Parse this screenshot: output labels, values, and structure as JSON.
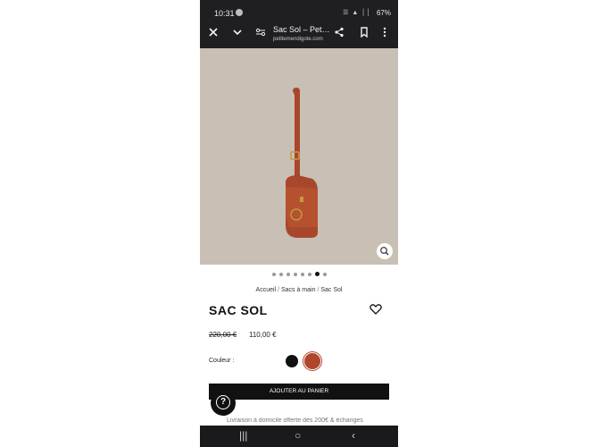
{
  "status_bar": {
    "time": "10:31",
    "notification_icon": "help-circle-icon",
    "signal_icons": "☰ ▲ ││",
    "battery": "67%"
  },
  "browser": {
    "close_icon": "close-icon",
    "collapse_icon": "chevron-down-icon",
    "site_settings_icon": "tune-icon",
    "title": "Sac Sol – Petite Mendigote",
    "url": "petitemendigote.com",
    "share_icon": "share-icon",
    "bookmark_icon": "bookmark-icon",
    "menu_icon": "more-vert-icon"
  },
  "gallery": {
    "dot_count": 8,
    "active_index": 6,
    "zoom_icon": "zoom-icon",
    "bg_color": "#c8bfb5"
  },
  "breadcrumb": [
    "Accueil",
    "Sacs à main",
    "Sac Sol"
  ],
  "product": {
    "title": "SAC SOL",
    "price_old": "220,00 €",
    "price_new": "110,00 €",
    "color_label": "Couleur :",
    "colors": [
      "#111111",
      "#b0472a"
    ],
    "add_to_cart": "AJOUTER AU PANIER",
    "promo": "Livraison à domicile offerte dès 200€ & échanges"
  },
  "help_icon": "help-circle-icon",
  "nav": {
    "recent": "|||",
    "home": "○",
    "back": "‹"
  }
}
